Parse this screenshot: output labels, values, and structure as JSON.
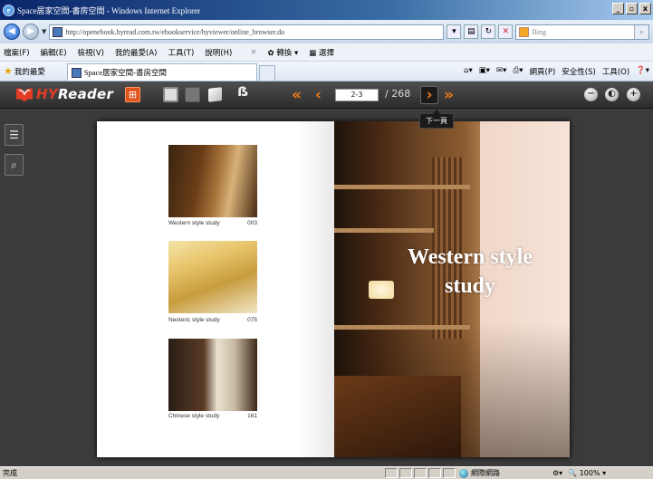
{
  "window": {
    "title": "Space居家空間-書房空間 - Windows Internet Explorer",
    "controls": [
      "_",
      "▫",
      "x"
    ]
  },
  "address_bar": {
    "url": "http://openebook.hyread.com.tw/ebookservice/hyviewer/online_browser.do",
    "search_placeholder": "Bing"
  },
  "menu": {
    "items": [
      "檔案(F)",
      "編輯(E)",
      "檢視(V)",
      "我的最愛(A)",
      "工具(T)",
      "說明(H)"
    ],
    "translate_label": "轉換",
    "select_label": "選擇"
  },
  "favorites_bar": {
    "favorites_label": "我的最愛",
    "tab_title": "Space居家空間-書房空間",
    "commands": [
      "網頁(P)",
      "安全性(S)",
      "工具(O)"
    ]
  },
  "reader": {
    "logo": {
      "prefix": "HY",
      "suffix": "Reader"
    },
    "page_input": "2-3",
    "page_total": "/ 268",
    "tooltip": "下一頁",
    "nav": {
      "first": "«",
      "prev": "‹",
      "next": "›",
      "last": "»"
    },
    "zoom": {
      "out": "−",
      "fit": "◐",
      "in": "+"
    }
  },
  "book": {
    "left_page": {
      "items": [
        {
          "caption": "Western style study",
          "page": "003"
        },
        {
          "caption": "Neoteric style study",
          "page": "075"
        },
        {
          "caption": "Chinese style study",
          "page": "161"
        }
      ]
    },
    "right_page": {
      "title_line1": "Western style",
      "title_line2": "study"
    }
  },
  "status_bar": {
    "status_text": "完成",
    "zone_label": "網際網路",
    "zoom_level": "100%"
  },
  "colors": {
    "accent_orange": "#f07a16",
    "titlebar": "#0a246a",
    "toolbar_dark": "#2c2c2c"
  }
}
